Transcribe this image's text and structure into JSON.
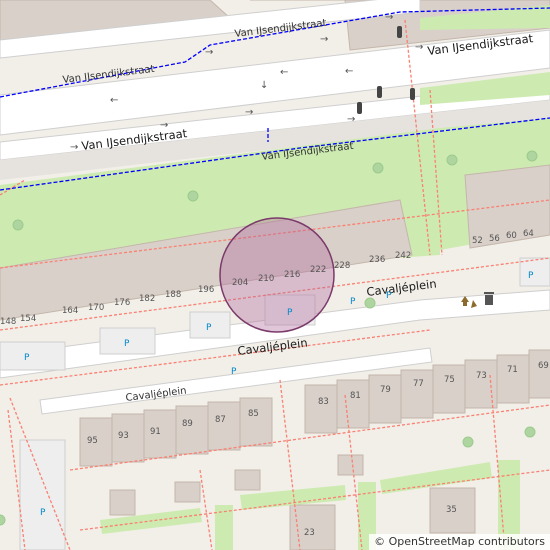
{
  "map": {
    "streets": [
      {
        "name": "Van IJsendijkstraat"
      },
      {
        "name": "Van IJsendijkstraat"
      },
      {
        "name": "Van IJsendijkstraat"
      },
      {
        "name": "Van IJsendijkstraat"
      },
      {
        "name": "Van IJsendijkstraat"
      },
      {
        "name": "Cavaljéplein"
      },
      {
        "name": "Cavaljéplein"
      },
      {
        "name": "Cavaljéplein"
      }
    ],
    "house_numbers": [
      "148",
      "154",
      "164",
      "170",
      "176",
      "182",
      "188",
      "196",
      "204",
      "210",
      "216",
      "222",
      "228",
      "236",
      "242",
      "52",
      "56",
      "60",
      "64",
      "95",
      "93",
      "91",
      "89",
      "87",
      "85",
      "83",
      "81",
      "79",
      "77",
      "75",
      "73",
      "71",
      "69",
      "35",
      "23"
    ],
    "parking_label": "P",
    "recycling_icon": "recycling-icon",
    "waste_icon": "waste-basket-icon",
    "traffic_signal_icon": "traffic-signal-icon",
    "marker": {
      "shape": "circle",
      "fill": "#b06a9a",
      "stroke": "#7a3a6a"
    },
    "colors": {
      "land": "#f2efe9",
      "park": "#cdebb0",
      "building": "#d9d0c9",
      "building_outline": "#c4b6ab",
      "road": "#ffffff",
      "footway": "#fa8072",
      "cycleway": "#0000ff"
    }
  },
  "attribution": {
    "symbol": "©",
    "text": "OpenStreetMap contributors"
  }
}
